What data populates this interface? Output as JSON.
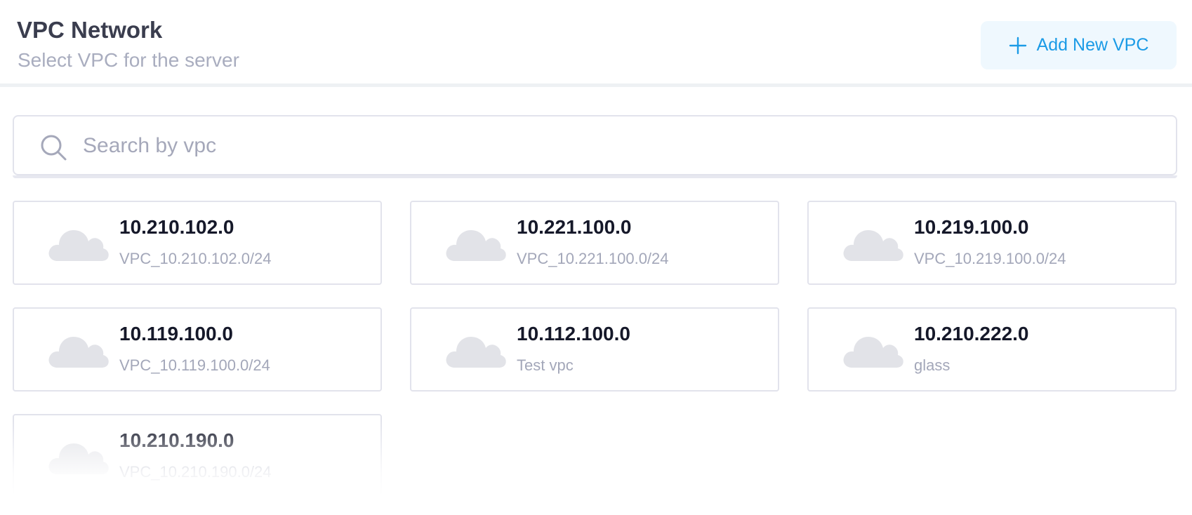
{
  "header": {
    "title": "VPC Network",
    "subtitle": "Select VPC for the server",
    "add_button_label": "Add New VPC"
  },
  "search": {
    "placeholder": "Search by vpc",
    "value": ""
  },
  "vpcs": [
    {
      "ip": "10.210.102.0",
      "name": "VPC_10.210.102.0/24"
    },
    {
      "ip": "10.221.100.0",
      "name": "VPC_10.221.100.0/24"
    },
    {
      "ip": "10.219.100.0",
      "name": "VPC_10.219.100.0/24"
    },
    {
      "ip": "10.119.100.0",
      "name": "VPC_10.119.100.0/24"
    },
    {
      "ip": "10.112.100.0",
      "name": "Test vpc"
    },
    {
      "ip": "10.210.222.0",
      "name": "glass"
    },
    {
      "ip": "10.210.190.0",
      "name": "VPC_10.210.190.0/24"
    }
  ],
  "icons": {
    "add": "plus-icon",
    "search": "search-icon",
    "vpc": "cloud-icon"
  },
  "colors": {
    "accent": "#1b9be6",
    "accent_bg": "#eff8fe",
    "cloud": "#e2e3e8"
  }
}
